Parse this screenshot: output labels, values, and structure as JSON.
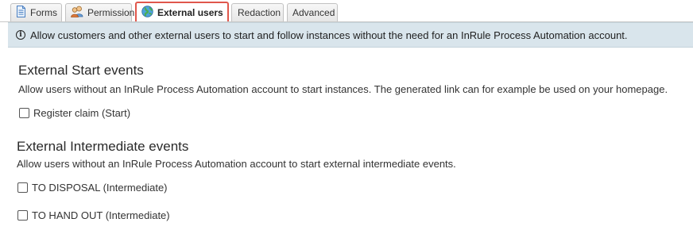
{
  "tabs": [
    {
      "label": "Forms",
      "icon": "document-icon"
    },
    {
      "label": "Permission",
      "icon": "users-icon"
    },
    {
      "label": "External users",
      "icon": "globe-icon",
      "active": true
    },
    {
      "label": "Redaction"
    },
    {
      "label": "Advanced"
    }
  ],
  "info": {
    "icon": "info-icon",
    "text": "Allow customers and other external users to start and follow instances without the need for an InRule Process Automation account."
  },
  "start_section": {
    "title": "External Start events",
    "description": "Allow users without an InRule Process Automation account to start instances. The generated link can for example be used on your homepage.",
    "events": [
      {
        "label": "Register claim (Start)",
        "checked": false
      }
    ]
  },
  "intermediate_section": {
    "title": "External Intermediate events",
    "description": "Allow users without an InRule Process Automation account to start external intermediate events.",
    "events": [
      {
        "label": "TO DISPOSAL (Intermediate)",
        "checked": false
      },
      {
        "label": "TO HAND OUT (Intermediate)",
        "checked": false
      }
    ]
  },
  "colors": {
    "active_tab_outline": "#e0574c",
    "info_background": "#d9e5ec"
  }
}
